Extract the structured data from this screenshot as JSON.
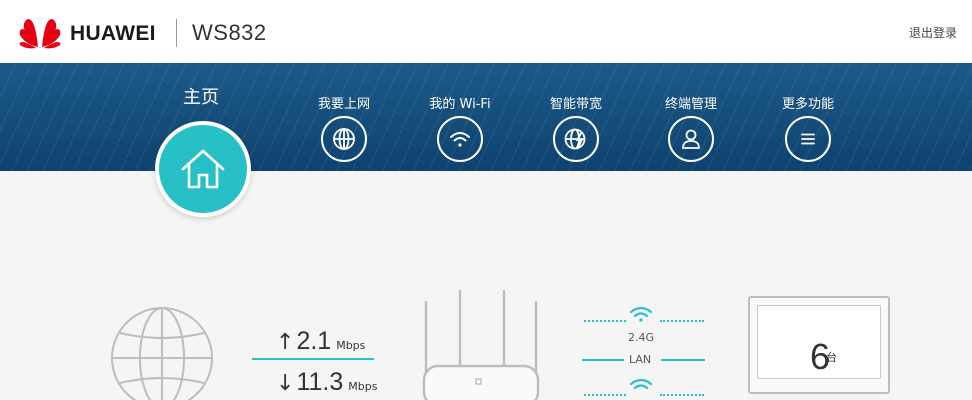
{
  "header": {
    "brand": "HUAWEI",
    "model": "WS832",
    "logout_label": "退出登录"
  },
  "nav": {
    "home_label": "主页",
    "items": [
      {
        "label": "我要上网",
        "icon": "globe-icon"
      },
      {
        "label": "我的 Wi-Fi",
        "icon": "wifi-icon"
      },
      {
        "label": "智能带宽",
        "icon": "bandwidth-icon"
      },
      {
        "label": "终端管理",
        "icon": "user-icon"
      },
      {
        "label": "更多功能",
        "icon": "menu-icon"
      }
    ]
  },
  "status": {
    "upload": {
      "value": "2.1",
      "unit": "Mbps"
    },
    "download": {
      "value": "11.3",
      "unit": "Mbps"
    },
    "wifi_band": "2.4G",
    "lan_label": "LAN",
    "device_count": "6",
    "device_unit": "台"
  },
  "colors": {
    "accent": "#27c0c6",
    "nav_bg": "#164f7c",
    "logo_red": "#e60012"
  }
}
